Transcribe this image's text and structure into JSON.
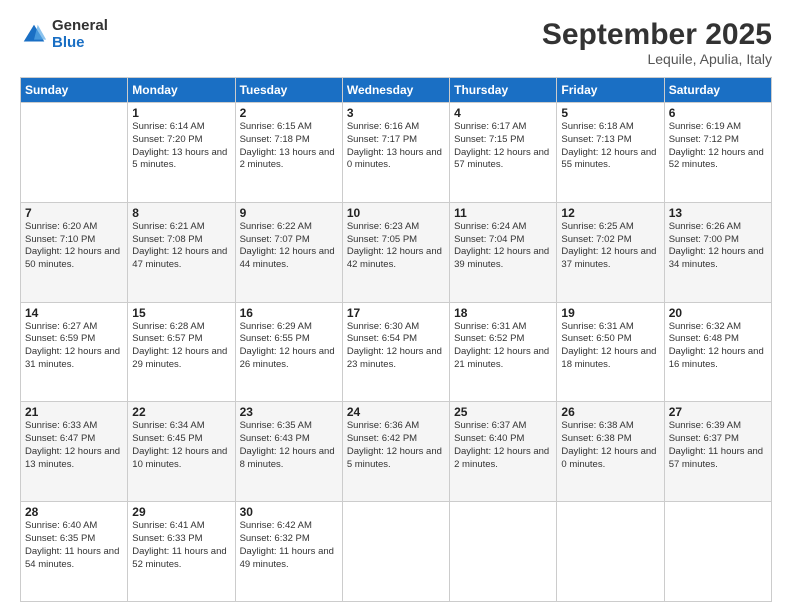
{
  "logo": {
    "general": "General",
    "blue": "Blue"
  },
  "header": {
    "month": "September 2025",
    "location": "Lequile, Apulia, Italy"
  },
  "weekdays": [
    "Sunday",
    "Monday",
    "Tuesday",
    "Wednesday",
    "Thursday",
    "Friday",
    "Saturday"
  ],
  "weeks": [
    [
      {
        "day": "",
        "sunrise": "",
        "sunset": "",
        "daylight": ""
      },
      {
        "day": "1",
        "sunrise": "Sunrise: 6:14 AM",
        "sunset": "Sunset: 7:20 PM",
        "daylight": "Daylight: 13 hours and 5 minutes."
      },
      {
        "day": "2",
        "sunrise": "Sunrise: 6:15 AM",
        "sunset": "Sunset: 7:18 PM",
        "daylight": "Daylight: 13 hours and 2 minutes."
      },
      {
        "day": "3",
        "sunrise": "Sunrise: 6:16 AM",
        "sunset": "Sunset: 7:17 PM",
        "daylight": "Daylight: 13 hours and 0 minutes."
      },
      {
        "day": "4",
        "sunrise": "Sunrise: 6:17 AM",
        "sunset": "Sunset: 7:15 PM",
        "daylight": "Daylight: 12 hours and 57 minutes."
      },
      {
        "day": "5",
        "sunrise": "Sunrise: 6:18 AM",
        "sunset": "Sunset: 7:13 PM",
        "daylight": "Daylight: 12 hours and 55 minutes."
      },
      {
        "day": "6",
        "sunrise": "Sunrise: 6:19 AM",
        "sunset": "Sunset: 7:12 PM",
        "daylight": "Daylight: 12 hours and 52 minutes."
      }
    ],
    [
      {
        "day": "7",
        "sunrise": "Sunrise: 6:20 AM",
        "sunset": "Sunset: 7:10 PM",
        "daylight": "Daylight: 12 hours and 50 minutes."
      },
      {
        "day": "8",
        "sunrise": "Sunrise: 6:21 AM",
        "sunset": "Sunset: 7:08 PM",
        "daylight": "Daylight: 12 hours and 47 minutes."
      },
      {
        "day": "9",
        "sunrise": "Sunrise: 6:22 AM",
        "sunset": "Sunset: 7:07 PM",
        "daylight": "Daylight: 12 hours and 44 minutes."
      },
      {
        "day": "10",
        "sunrise": "Sunrise: 6:23 AM",
        "sunset": "Sunset: 7:05 PM",
        "daylight": "Daylight: 12 hours and 42 minutes."
      },
      {
        "day": "11",
        "sunrise": "Sunrise: 6:24 AM",
        "sunset": "Sunset: 7:04 PM",
        "daylight": "Daylight: 12 hours and 39 minutes."
      },
      {
        "day": "12",
        "sunrise": "Sunrise: 6:25 AM",
        "sunset": "Sunset: 7:02 PM",
        "daylight": "Daylight: 12 hours and 37 minutes."
      },
      {
        "day": "13",
        "sunrise": "Sunrise: 6:26 AM",
        "sunset": "Sunset: 7:00 PM",
        "daylight": "Daylight: 12 hours and 34 minutes."
      }
    ],
    [
      {
        "day": "14",
        "sunrise": "Sunrise: 6:27 AM",
        "sunset": "Sunset: 6:59 PM",
        "daylight": "Daylight: 12 hours and 31 minutes."
      },
      {
        "day": "15",
        "sunrise": "Sunrise: 6:28 AM",
        "sunset": "Sunset: 6:57 PM",
        "daylight": "Daylight: 12 hours and 29 minutes."
      },
      {
        "day": "16",
        "sunrise": "Sunrise: 6:29 AM",
        "sunset": "Sunset: 6:55 PM",
        "daylight": "Daylight: 12 hours and 26 minutes."
      },
      {
        "day": "17",
        "sunrise": "Sunrise: 6:30 AM",
        "sunset": "Sunset: 6:54 PM",
        "daylight": "Daylight: 12 hours and 23 minutes."
      },
      {
        "day": "18",
        "sunrise": "Sunrise: 6:31 AM",
        "sunset": "Sunset: 6:52 PM",
        "daylight": "Daylight: 12 hours and 21 minutes."
      },
      {
        "day": "19",
        "sunrise": "Sunrise: 6:31 AM",
        "sunset": "Sunset: 6:50 PM",
        "daylight": "Daylight: 12 hours and 18 minutes."
      },
      {
        "day": "20",
        "sunrise": "Sunrise: 6:32 AM",
        "sunset": "Sunset: 6:48 PM",
        "daylight": "Daylight: 12 hours and 16 minutes."
      }
    ],
    [
      {
        "day": "21",
        "sunrise": "Sunrise: 6:33 AM",
        "sunset": "Sunset: 6:47 PM",
        "daylight": "Daylight: 12 hours and 13 minutes."
      },
      {
        "day": "22",
        "sunrise": "Sunrise: 6:34 AM",
        "sunset": "Sunset: 6:45 PM",
        "daylight": "Daylight: 12 hours and 10 minutes."
      },
      {
        "day": "23",
        "sunrise": "Sunrise: 6:35 AM",
        "sunset": "Sunset: 6:43 PM",
        "daylight": "Daylight: 12 hours and 8 minutes."
      },
      {
        "day": "24",
        "sunrise": "Sunrise: 6:36 AM",
        "sunset": "Sunset: 6:42 PM",
        "daylight": "Daylight: 12 hours and 5 minutes."
      },
      {
        "day": "25",
        "sunrise": "Sunrise: 6:37 AM",
        "sunset": "Sunset: 6:40 PM",
        "daylight": "Daylight: 12 hours and 2 minutes."
      },
      {
        "day": "26",
        "sunrise": "Sunrise: 6:38 AM",
        "sunset": "Sunset: 6:38 PM",
        "daylight": "Daylight: 12 hours and 0 minutes."
      },
      {
        "day": "27",
        "sunrise": "Sunrise: 6:39 AM",
        "sunset": "Sunset: 6:37 PM",
        "daylight": "Daylight: 11 hours and 57 minutes."
      }
    ],
    [
      {
        "day": "28",
        "sunrise": "Sunrise: 6:40 AM",
        "sunset": "Sunset: 6:35 PM",
        "daylight": "Daylight: 11 hours and 54 minutes."
      },
      {
        "day": "29",
        "sunrise": "Sunrise: 6:41 AM",
        "sunset": "Sunset: 6:33 PM",
        "daylight": "Daylight: 11 hours and 52 minutes."
      },
      {
        "day": "30",
        "sunrise": "Sunrise: 6:42 AM",
        "sunset": "Sunset: 6:32 PM",
        "daylight": "Daylight: 11 hours and 49 minutes."
      },
      {
        "day": "",
        "sunrise": "",
        "sunset": "",
        "daylight": ""
      },
      {
        "day": "",
        "sunrise": "",
        "sunset": "",
        "daylight": ""
      },
      {
        "day": "",
        "sunrise": "",
        "sunset": "",
        "daylight": ""
      },
      {
        "day": "",
        "sunrise": "",
        "sunset": "",
        "daylight": ""
      }
    ]
  ]
}
